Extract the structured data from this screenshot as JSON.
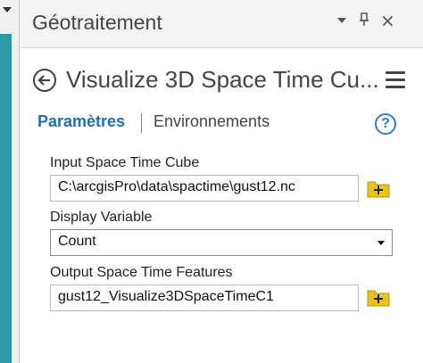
{
  "pane": {
    "title": "Géotraitement",
    "close_glyph": "×",
    "pin_glyph": "∙"
  },
  "tool": {
    "title": "Visualize 3D Space Time Cu...",
    "back_icon": "back-arrow-circle-icon",
    "menu_icon": "hamburger-menu-icon"
  },
  "tabs": {
    "parameters": "Paramètres",
    "environments": "Environnements",
    "help": "?"
  },
  "params": {
    "input_cube": {
      "label": "Input Space Time Cube",
      "value": "C:\\arcgisPro\\data\\spactime\\gust12.nc"
    },
    "display_variable": {
      "label": "Display Variable",
      "value": "Count"
    },
    "output_features": {
      "label": "Output Space Time Features",
      "value": "gust12_Visualize3DSpaceTimeC1"
    }
  },
  "colors": {
    "accent_blue": "#1f6fb5",
    "folder_yellow": "#e8c31d",
    "teal_strip": "#2e9aa8"
  }
}
